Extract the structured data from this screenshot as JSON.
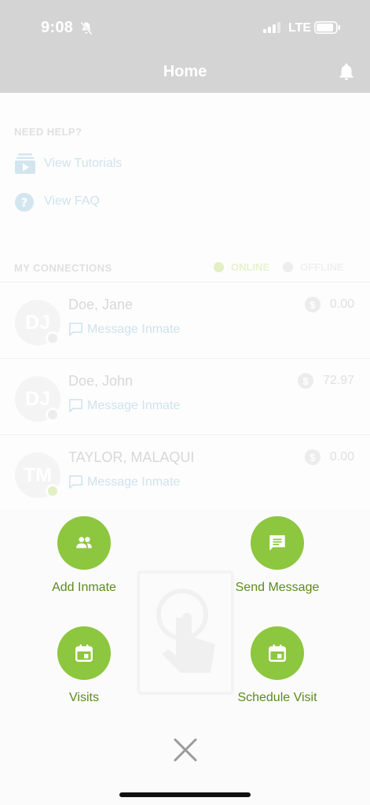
{
  "status_bar": {
    "time": "9:08",
    "network": "LTE"
  },
  "header": {
    "title": "Home"
  },
  "help": {
    "section_label": "NEED HELP?",
    "items": [
      {
        "label": "View Tutorials",
        "icon": "video-tutorial-icon"
      },
      {
        "label": "View FAQ",
        "icon": "question-icon"
      }
    ]
  },
  "connections": {
    "section_label": "MY CONNECTIONS",
    "legend": {
      "online": "ONLINE",
      "offline": "OFFLINE"
    },
    "items": [
      {
        "initials": "DJ",
        "name": "Doe, Jane",
        "balance": "0.00",
        "message_label": "Message Inmate",
        "status": "offline"
      },
      {
        "initials": "DJ",
        "name": "Doe, John",
        "balance": "72.97",
        "message_label": "Message Inmate",
        "status": "offline"
      },
      {
        "initials": "TM",
        "name": "TAYLOR, MALAQUI",
        "balance": "0.00",
        "message_label": "Message Inmate",
        "status": "online"
      }
    ]
  },
  "actions": [
    {
      "label": "Add Inmate",
      "icon": "people-icon"
    },
    {
      "label": "Send Message",
      "icon": "message-icon"
    },
    {
      "label": "Visits",
      "icon": "calendar-icon"
    },
    {
      "label": "Schedule Visit",
      "icon": "calendar-icon"
    }
  ],
  "colors": {
    "accent": "#8dc63f",
    "accent_text": "#5d8b1a",
    "header_bg": "#d4d4d4",
    "online_dot": "#e3efc4",
    "offline_dot": "#ededed"
  }
}
